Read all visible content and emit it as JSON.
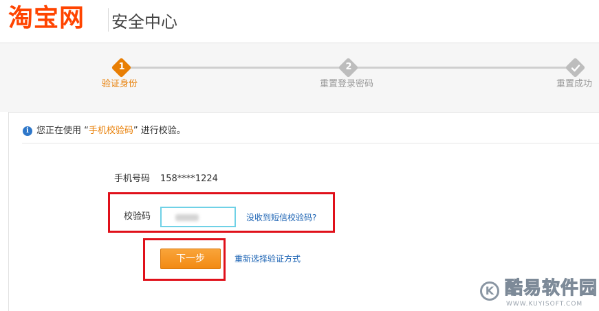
{
  "header": {
    "logo": "淘宝网",
    "title": "安全中心"
  },
  "steps": [
    {
      "num": "1",
      "label": "验证身份",
      "state": "active"
    },
    {
      "num": "2",
      "label": "重置登录密码",
      "state": "pending"
    },
    {
      "icon": "check-icon",
      "label": "重置成功",
      "state": "pending"
    }
  ],
  "info": {
    "prefix": "您正在使用 “",
    "method": "手机校验码",
    "suffix": "” 进行校验。"
  },
  "form": {
    "phone_label": "手机号码",
    "phone_value": "158****1224",
    "code_label": "校验码",
    "code_value": "",
    "no_sms_link": "没收到短信校验码?",
    "next_button": "下一步",
    "change_method_link": "重新选择验证方式"
  },
  "watermark": {
    "text": "酷易软件园",
    "url": "WWW.KUYISOFT.COM"
  },
  "colors": {
    "brand": "#ff4400",
    "active_step": "#e87e04",
    "pending_step": "#bdbdbd",
    "highlight_box": "#e0101a",
    "link": "#1a62b3"
  }
}
